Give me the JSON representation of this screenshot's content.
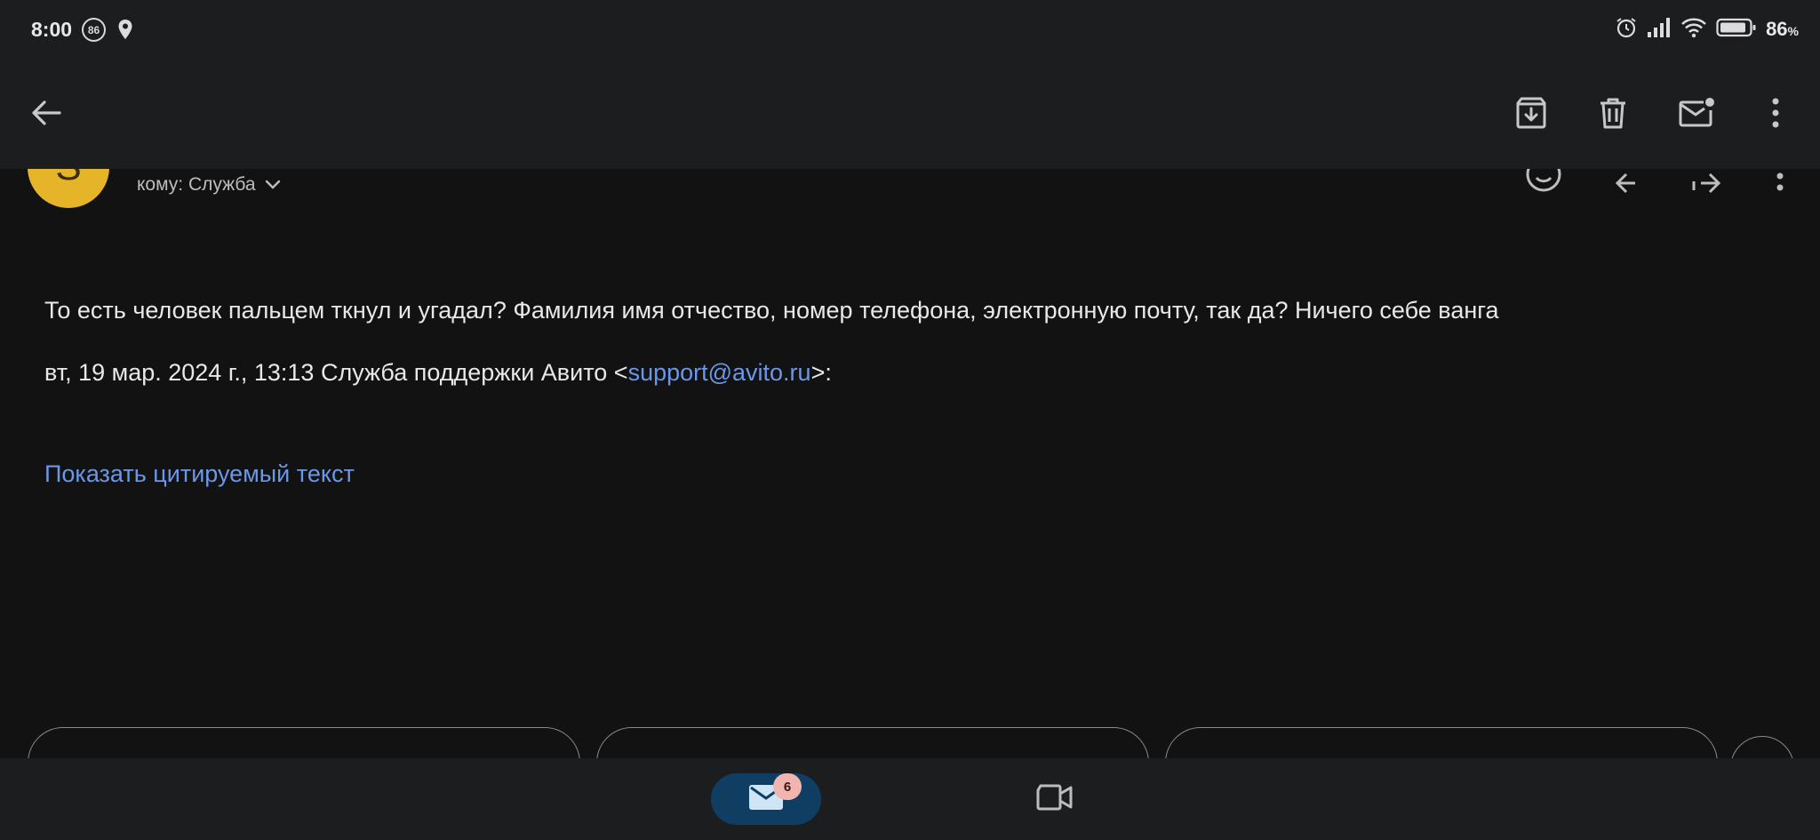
{
  "status": {
    "time": "8:00",
    "notif_count": "86",
    "battery_percent": "86",
    "battery_unit": "%"
  },
  "toolbar": {
    "back_icon": "arrow-left-icon",
    "archive_icon": "archive-icon",
    "delete_icon": "trash-icon",
    "mark_unread_icon": "mail-unread-icon",
    "more_icon": "more-vert-icon"
  },
  "message": {
    "sender_initial": "S",
    "recipient": "кому: Служба",
    "reply_text": "То есть человек пальцем ткнул и угадал? Фамилия имя отчество, номер телефона, электронную почту, так да? Ничего себе ванга",
    "quote_header_prefix": "вт, 19 мар. 2024 г., 13:13 Служба поддержки Авито <",
    "quote_email": "support@avito.ru",
    "quote_header_suffix": ">:",
    "show_quoted": "Показать цитируемый текст"
  },
  "bottom_nav": {
    "mail_badge": "6",
    "mail_icon": "mail-icon",
    "meet_icon": "video-camera-icon"
  },
  "colors": {
    "background": "#121212",
    "surface": "#1c1d1f",
    "link": "#6a97e8",
    "avatar": "#e6b428",
    "nav_active": "#0f3e62",
    "badge": "#f2b4ae"
  }
}
